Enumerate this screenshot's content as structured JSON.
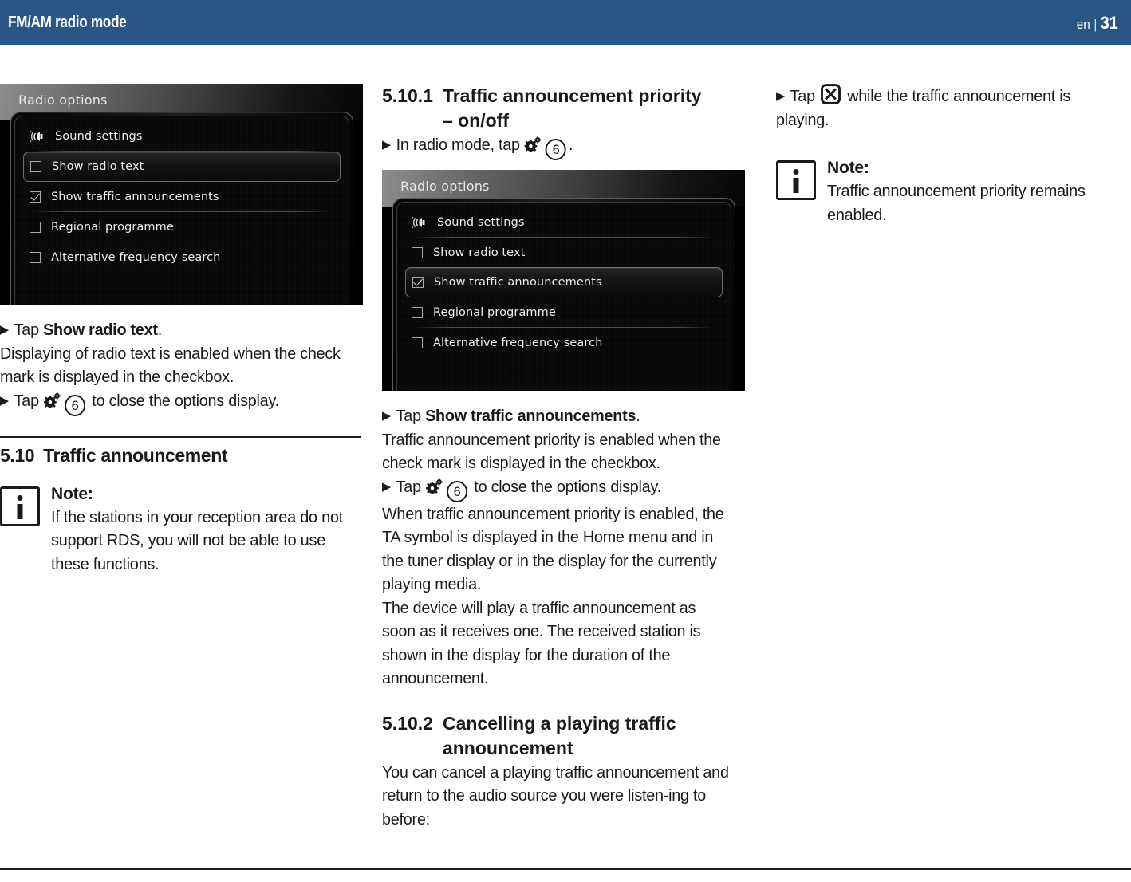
{
  "header": {
    "title": "FM/AM radio mode",
    "language": "en",
    "separator": "|",
    "page_number": "31"
  },
  "icons": {
    "gear": "settings-gear-icon",
    "circled_six": "6",
    "cancel": "cancel-x-icon",
    "note": "info-icon",
    "speaker": "sound-speaker-icon",
    "bullet_arrow": "▶"
  },
  "screenshot_left": {
    "title": "Radio options",
    "rows": [
      {
        "label": "Sound settings",
        "type": "icon",
        "icon": "speaker",
        "selected": false
      },
      {
        "label": "Show radio text",
        "type": "checkbox",
        "checked": false,
        "selected": true
      },
      {
        "label": "Show traffic announcements",
        "type": "checkbox",
        "checked": true,
        "selected": false
      },
      {
        "label": "Regional programme",
        "type": "checkbox",
        "checked": false,
        "selected": false
      },
      {
        "label": "Alternative frequency search",
        "type": "checkbox",
        "checked": false,
        "selected": false
      }
    ]
  },
  "screenshot_mid": {
    "title": "Radio options",
    "rows": [
      {
        "label": "Sound settings",
        "type": "icon",
        "icon": "speaker",
        "selected": false
      },
      {
        "label": "Show radio text",
        "type": "checkbox",
        "checked": false,
        "selected": false
      },
      {
        "label": "Show traffic announcements",
        "type": "checkbox",
        "checked": true,
        "selected": true
      },
      {
        "label": "Regional programme",
        "type": "checkbox",
        "checked": false,
        "selected": false
      },
      {
        "label": "Alternative frequency search",
        "type": "checkbox",
        "checked": false,
        "selected": false
      }
    ]
  },
  "left_column": {
    "step1_pre": "Tap ",
    "step1_bold": "Show radio text",
    "step1_post": ".",
    "para1": "Displaying of radio text is enabled when the check mark is displayed in the checkbox.",
    "step2_pre": "Tap ",
    "step2_mid": " ",
    "step2_post": " to close the options display.",
    "heading": {
      "number": "5.10",
      "text": "Traffic announcement"
    },
    "note": {
      "title": "Note:",
      "text": "If the stations in your reception area do not support RDS, you will not be able to use these functions."
    }
  },
  "mid_column": {
    "heading": {
      "number": "5.10.1",
      "line1": "Traffic announcement priority",
      "line2": "– on/off"
    },
    "step1_pre": "In radio mode, tap ",
    "step1_post": ".",
    "step2_pre": "Tap ",
    "step2_bold": "Show traffic announcements",
    "step2_post": ".",
    "para1": "Traffic announcement priority is enabled when the check mark is displayed in the checkbox.",
    "step3_pre": "Tap ",
    "step3_post": " to close the options display.",
    "para2": "When traffic announcement priority is enabled, the TA symbol is displayed in the Home menu and in the tuner display or in the display for the currently playing media.",
    "para3": "The device will play a traffic announcement as soon as it receives one. The received station is shown in the display for the duration of the announcement.",
    "heading2": {
      "number": "5.10.2",
      "line1": "Cancelling a playing traffic",
      "line2": "announcement"
    },
    "para4": "You can cancel a playing traffic announcement and return to the audio source you were listen-ing to before:"
  },
  "right_column": {
    "step1_pre": "Tap ",
    "step1_post": " while the traffic announcement is playing.",
    "note": {
      "title": "Note:",
      "text": "Traffic announcement priority remains enabled."
    }
  }
}
